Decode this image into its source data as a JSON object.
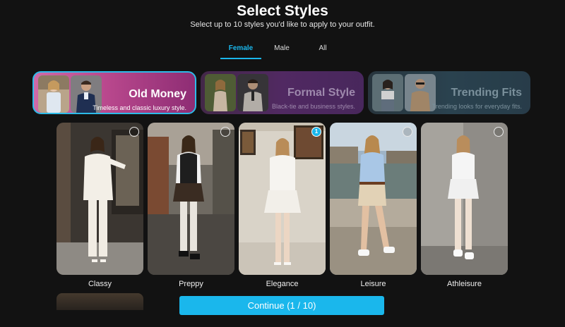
{
  "header": {
    "title": "Select Styles",
    "subtitle": "Select up to 10 styles you'd like to apply to your outfit."
  },
  "tabs": [
    {
      "label": "Female",
      "active": true
    },
    {
      "label": "Male",
      "active": false
    },
    {
      "label": "All",
      "active": false
    }
  ],
  "categories": [
    {
      "title": "Old Money",
      "subtitle": "Timeless and classic luxury style.",
      "selected": true
    },
    {
      "title": "Formal Style",
      "subtitle": "Black-tie and business styles.",
      "selected": false
    },
    {
      "title": "Trending Fits",
      "subtitle": "Trending looks for everyday fits.",
      "selected": false
    }
  ],
  "styles": [
    {
      "label": "Classy",
      "selected": false
    },
    {
      "label": "Preppy",
      "selected": false
    },
    {
      "label": "Elegance",
      "selected": true,
      "badge": "1"
    },
    {
      "label": "Leisure",
      "selected": false
    },
    {
      "label": "Athleisure",
      "selected": false
    }
  ],
  "footer": {
    "continue_label": "Continue (1 / 10)"
  },
  "colors": {
    "accent": "#1ab7ec",
    "background": "#121212"
  }
}
